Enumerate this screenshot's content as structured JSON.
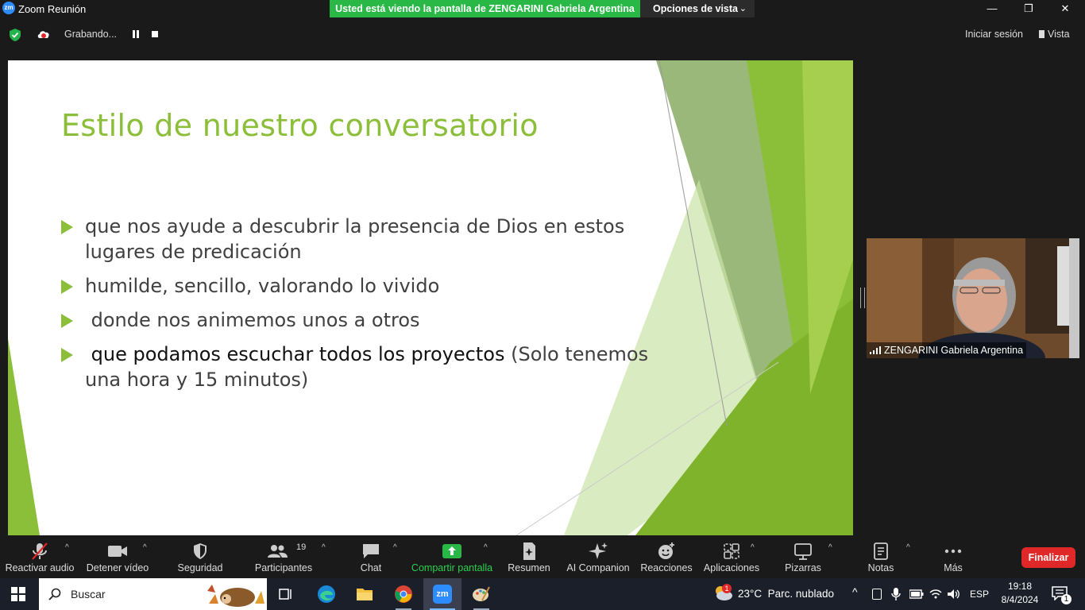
{
  "window": {
    "app_logo": "zm",
    "title": "Zoom Reunión",
    "share_banner": "Usted está viendo la pantalla de ZENGARINI Gabriela Argentina",
    "view_options": "Opciones de vista"
  },
  "topbar": {
    "recording_label": "Grabando...",
    "signin": "Iniciar sesión",
    "view": "Vista"
  },
  "slide": {
    "title": "Estilo de nuestro conversatorio",
    "bullets": [
      {
        "text": "que nos ayude a descubrir la presencia de Dios en estos lugares de predicación"
      },
      {
        "text": "humilde, sencillo, valorando lo vivido"
      },
      {
        "text": " donde nos animemos unos a otros"
      },
      {
        "text_main": " que podamos escuchar todos los proyectos",
        "text_rest": " (Solo tenemos una hora y 15 minutos)"
      }
    ],
    "accent_color": "#8bbf3a"
  },
  "video": {
    "participant_name": "ZENGARINI Gabriela Argentina"
  },
  "toolbar": {
    "items": [
      {
        "label": "Reactivar audio",
        "icon": "mic-muted-icon"
      },
      {
        "label": "Detener vídeo",
        "icon": "video-camera-icon"
      },
      {
        "label": "Seguridad",
        "icon": "shield-icon"
      },
      {
        "label": "Participantes",
        "icon": "participants-icon",
        "count": "19"
      },
      {
        "label": "Chat",
        "icon": "chat-bubble-icon"
      },
      {
        "label": "Compartir pantalla",
        "icon": "share-screen-icon"
      },
      {
        "label": "Resumen",
        "icon": "summary-doc-icon"
      },
      {
        "label": "AI Companion",
        "icon": "sparkle-icon"
      },
      {
        "label": "Reacciones",
        "icon": "emoji-add-icon"
      },
      {
        "label": "Aplicaciones",
        "icon": "apps-icon"
      },
      {
        "label": "Pizarras",
        "icon": "whiteboard-icon"
      },
      {
        "label": "Notas",
        "icon": "notes-icon"
      },
      {
        "label": "Más",
        "icon": "more-dots-icon"
      }
    ],
    "end_button": "Finalizar",
    "share_color": "#29b846",
    "end_color": "#e02828"
  },
  "taskbar": {
    "search_placeholder": "Buscar",
    "weather": "23°C  Parc. nublado",
    "weather_badge": "1",
    "language": "ESP",
    "time": "19:18",
    "date": "8/4/2024",
    "notifications": "1"
  }
}
